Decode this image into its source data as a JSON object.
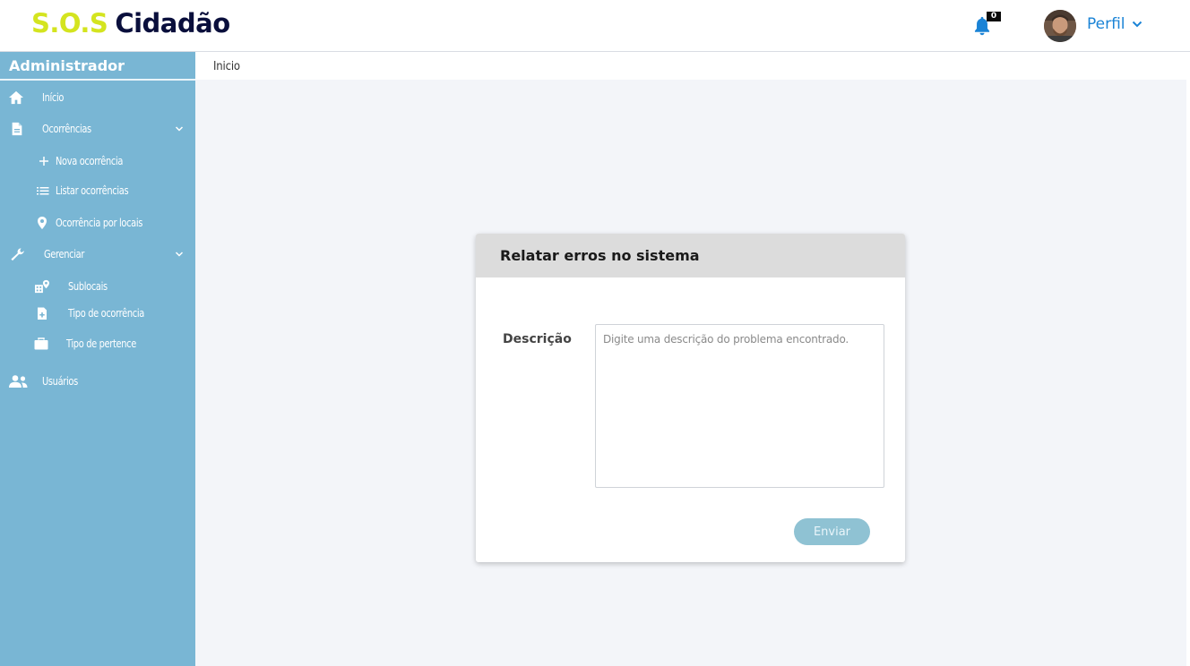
{
  "header": {
    "logo_part1": "S.O.S",
    "logo_part2": "Cidadão",
    "notification_count": "0",
    "profile_label": "Perfil",
    "icons": {
      "notifications": "bell-icon",
      "profile_dropdown": "chevron-down-icon"
    }
  },
  "sidebar": {
    "title": "Administrador",
    "items": [
      {
        "label": "Início",
        "icon": "home-icon"
      },
      {
        "label": "Ocorrências",
        "icon": "document-icon",
        "expandable": true
      },
      {
        "label": "Nova ocorrência",
        "icon": "plus-icon"
      },
      {
        "label": "Listar ocorrências",
        "icon": "list-icon"
      },
      {
        "label": "Ocorrência por locais",
        "icon": "map-pin-icon"
      },
      {
        "label": "Gerenciar",
        "icon": "wrench-icon",
        "expandable": true
      },
      {
        "label": "Sublocais",
        "icon": "building-pin-icon"
      },
      {
        "label": "Tipo de ocorrência",
        "icon": "file-plus-icon"
      },
      {
        "label": "Tipo de pertence",
        "icon": "briefcase-icon"
      },
      {
        "label": "Usuários",
        "icon": "users-icon"
      }
    ]
  },
  "breadcrumb": {
    "current": "Inicio"
  },
  "modal": {
    "title": "Relatar erros no sistema",
    "description_label": "Descrição",
    "description_placeholder": "Digite uma descrição do problema encontrado.",
    "description_value": "",
    "submit_label": "Enviar"
  },
  "colors": {
    "sidebar_bg": "#79b6d4",
    "logo_accent": "#d4e41f",
    "logo_dark": "#0a0f3c",
    "link_blue": "#1a83d6",
    "button_bg": "#8fc2d3",
    "page_bg": "#f3f5f9"
  }
}
